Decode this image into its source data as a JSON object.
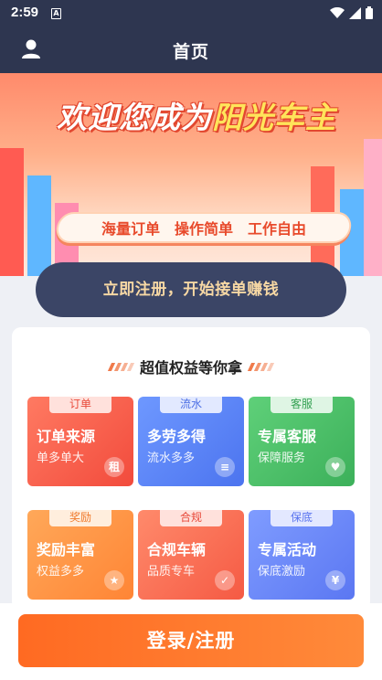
{
  "status": {
    "time": "2:59",
    "app_badge": "A"
  },
  "header": {
    "title": "首页",
    "user_icon": "user-icon"
  },
  "banner": {
    "title_part1": "欢迎您成为",
    "title_part2": "阳光车主",
    "slogans": [
      "海量订单",
      "操作简单",
      "工作自由"
    ]
  },
  "register_pill": {
    "label": "立即注册，开始接单赚钱"
  },
  "benefits": {
    "heading": "超值权益等你拿",
    "tiles": [
      {
        "tab": "订单",
        "title": "订单来源",
        "subtitle": "单多单大",
        "badge": "租"
      },
      {
        "tab": "流水",
        "title": "多劳多得",
        "subtitle": "流水多多",
        "badge": "≡"
      },
      {
        "tab": "客服",
        "title": "专属客服",
        "subtitle": "保障服务",
        "badge": "♥"
      },
      {
        "tab": "奖励",
        "title": "奖励丰富",
        "subtitle": "权益多多",
        "badge": "★"
      },
      {
        "tab": "合规",
        "title": "合规车辆",
        "subtitle": "品质专车",
        "badge": "✓"
      },
      {
        "tab": "保底",
        "title": "专属活动",
        "subtitle": "保底激励",
        "badge": "¥"
      }
    ]
  },
  "bottom": {
    "login_label": "登录/注册"
  },
  "colors": {
    "header_bg": "#2e3650",
    "accent": "#ff6a22",
    "pill_bg": "#3b4566"
  }
}
